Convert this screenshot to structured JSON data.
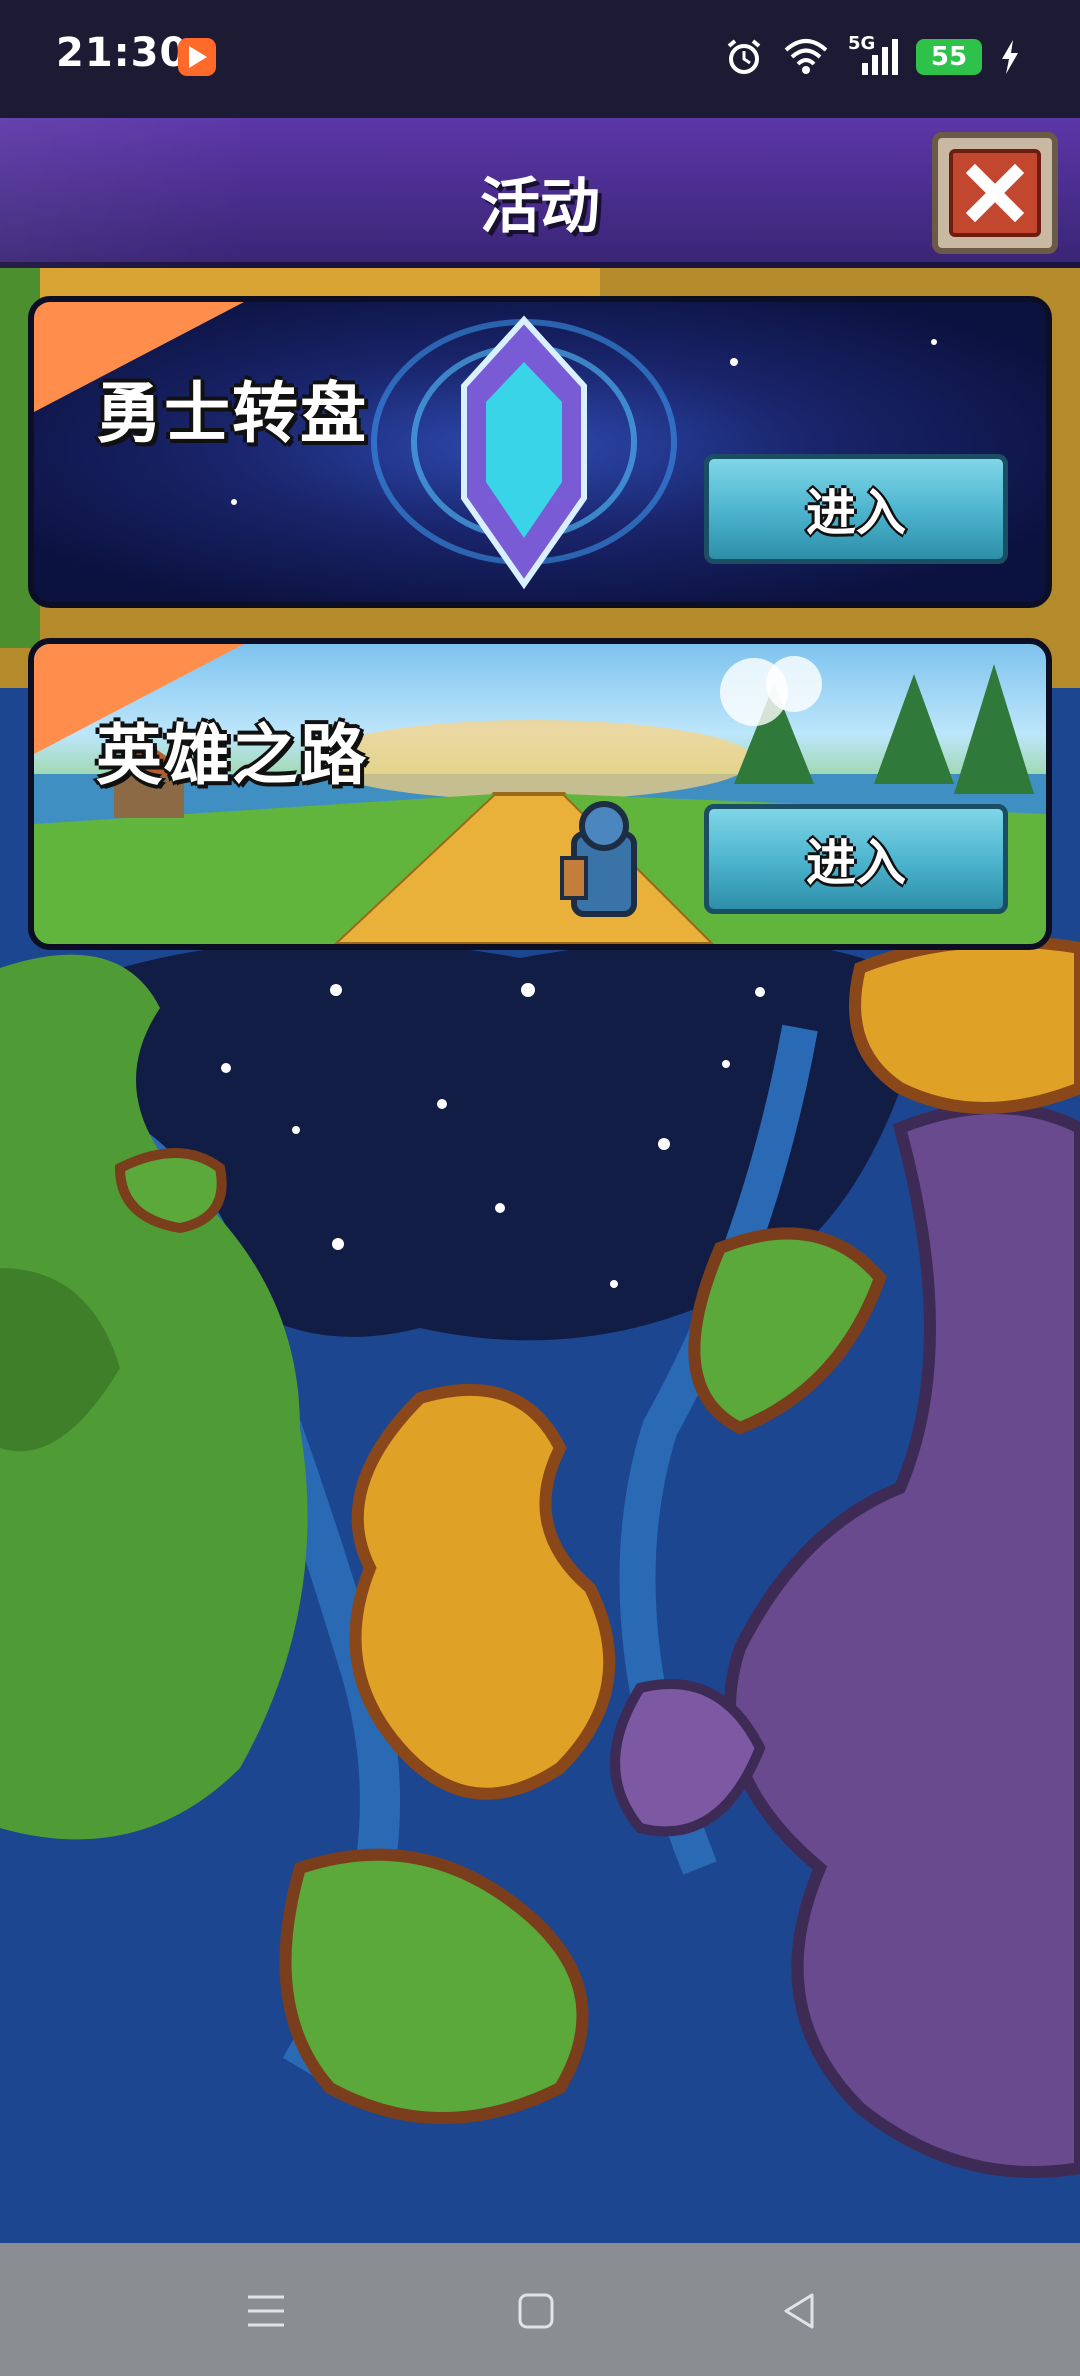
{
  "status_bar": {
    "time": "21:30",
    "network": "5G",
    "battery": "55"
  },
  "header": {
    "title": "活动"
  },
  "activities": [
    {
      "title": "勇士转盘",
      "enter_label": "进入"
    },
    {
      "title": "英雄之路",
      "enter_label": "进入"
    }
  ],
  "colors": {
    "header": "#4a2d8c",
    "corner_tag": "#ff8e4d",
    "enter_button": "#4ab2cc",
    "close_button": "#c3472f"
  },
  "icons": [
    "app-badge-icon",
    "alarm-icon",
    "wifi-icon",
    "signal-icon",
    "charging-icon",
    "close-icon",
    "menu-icon",
    "home-icon",
    "back-icon"
  ]
}
